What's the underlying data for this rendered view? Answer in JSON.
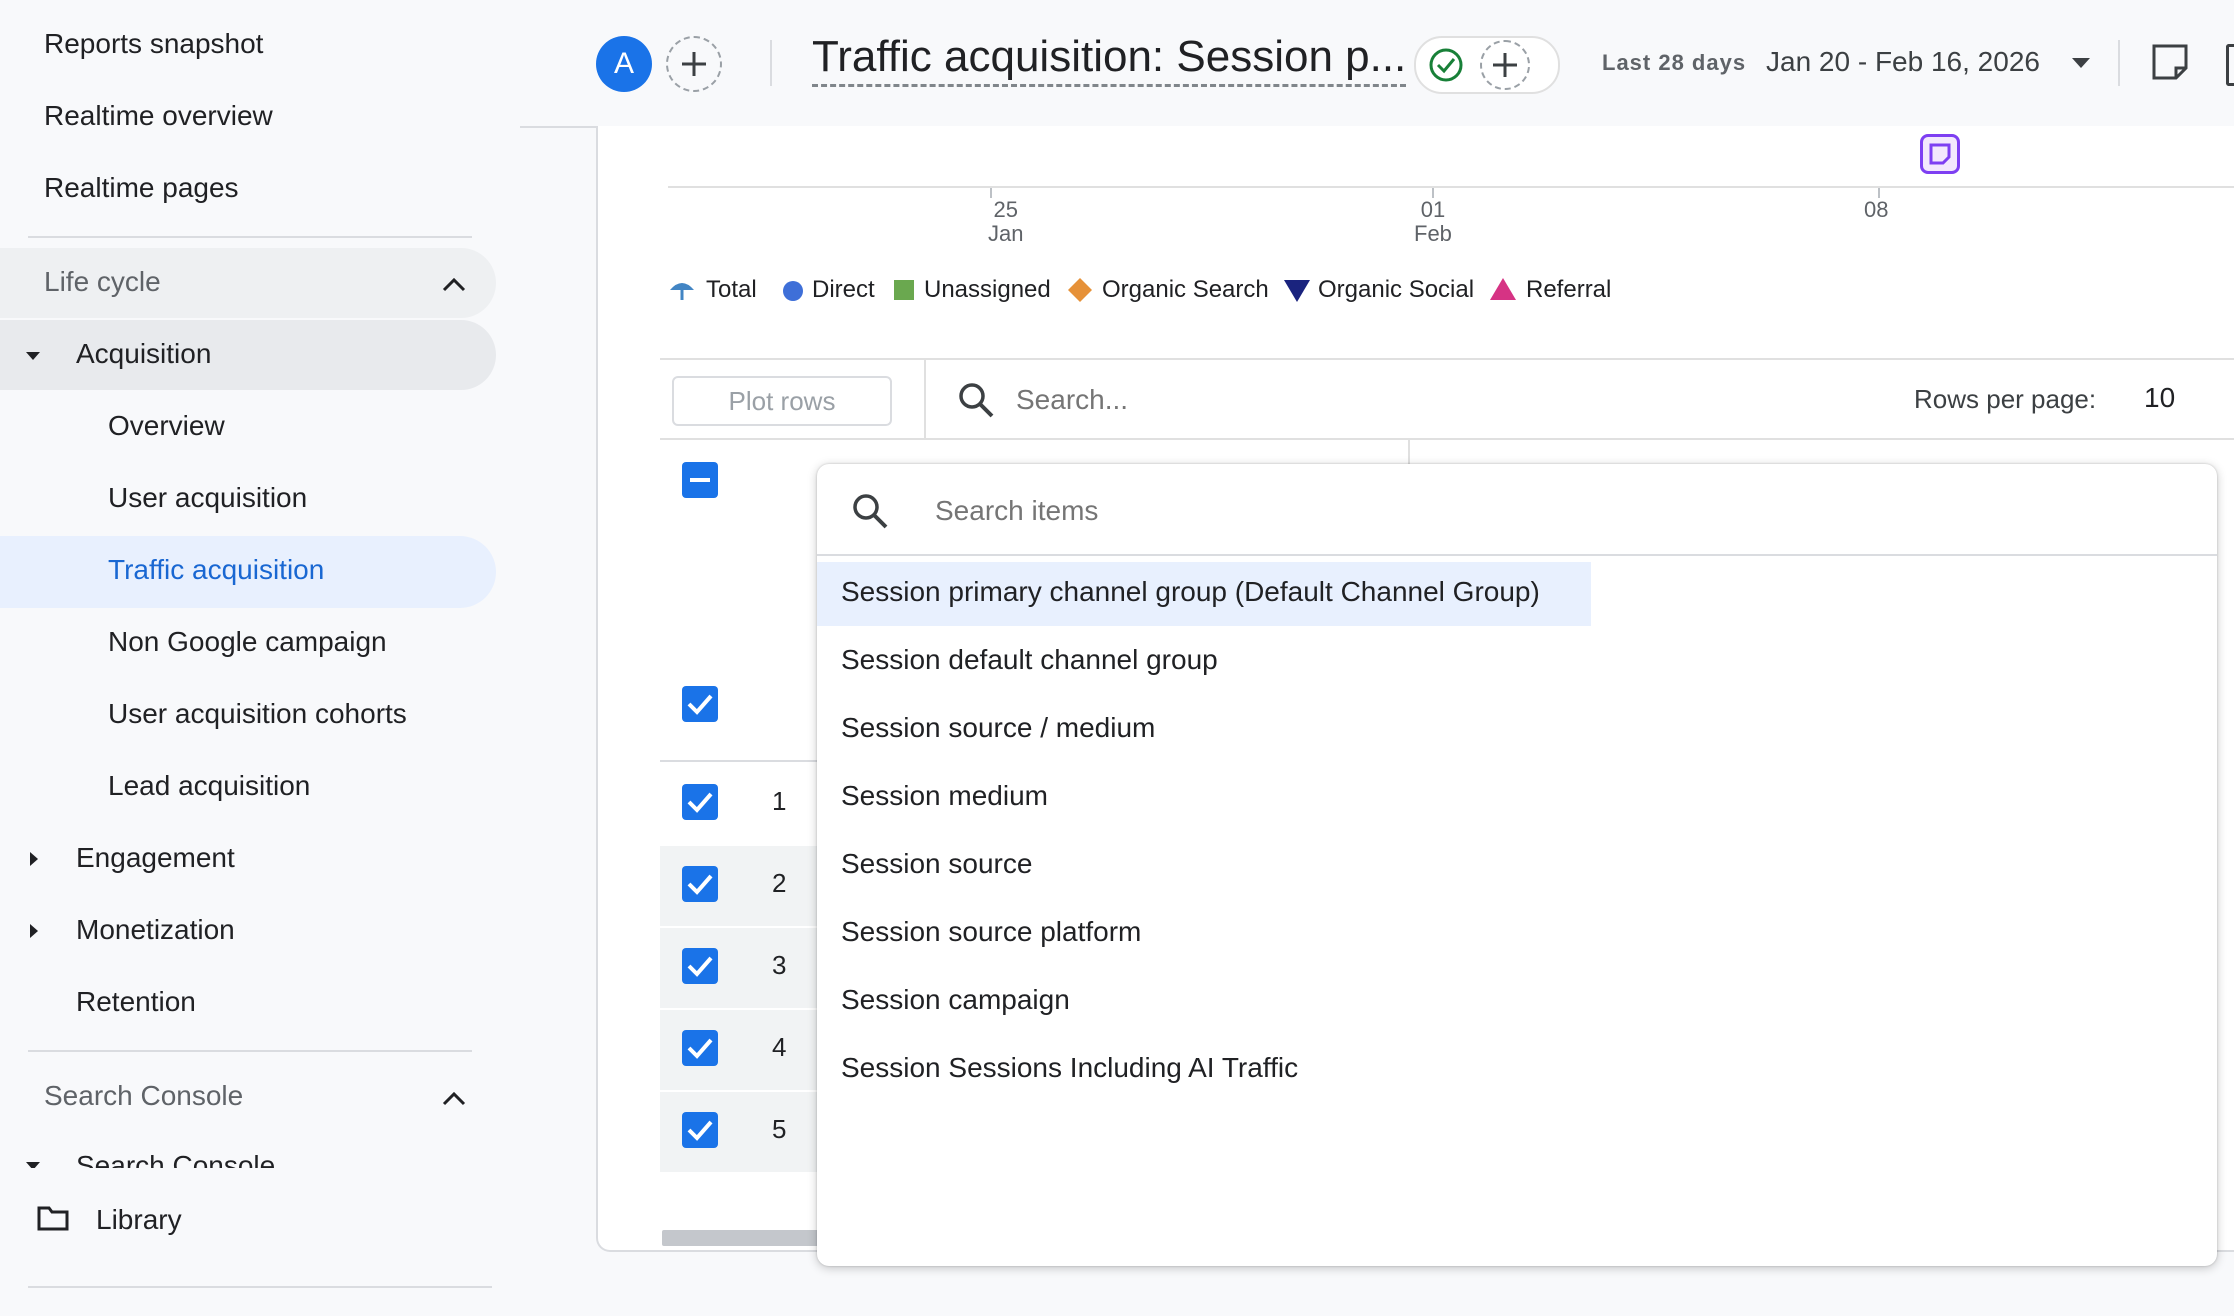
{
  "sidebar": {
    "top_items": [
      "Reports snapshot",
      "Realtime overview",
      "Realtime pages"
    ],
    "lifecycle": {
      "label": "Life cycle",
      "acquisition": {
        "label": "Acquisition",
        "children": [
          "Overview",
          "User acquisition",
          "Traffic acquisition",
          "Non Google campaign",
          "User acquisition cohorts",
          "Lead acquisition"
        ],
        "active": "Traffic acquisition"
      },
      "engagement": "Engagement",
      "monetization": "Monetization",
      "retention": "Retention"
    },
    "search_console": {
      "label": "Search Console",
      "child_partial": "Search Console"
    },
    "library": "Library"
  },
  "header": {
    "avatar_letter": "A",
    "title": "Traffic acquisition: Session p...",
    "date_label": "Last 28 days",
    "date_range": "Jan 20 - Feb 16, 2026"
  },
  "chart": {
    "x_ticks": [
      {
        "day": "25",
        "month": "Jan"
      },
      {
        "day": "01",
        "month": "Feb"
      },
      {
        "day": "08",
        "month": ""
      }
    ],
    "legend": [
      {
        "name": "Total",
        "color": "#4285c4",
        "shape": "umbrella"
      },
      {
        "name": "Direct",
        "color": "#3e6fd8",
        "shape": "circle"
      },
      {
        "name": "Unassigned",
        "color": "#6aa84f",
        "shape": "square"
      },
      {
        "name": "Organic Search",
        "color": "#e69138",
        "shape": "diamond"
      },
      {
        "name": "Organic Social",
        "color": "#1a237e",
        "shape": "triangle-down"
      },
      {
        "name": "Referral",
        "color": "#d63384",
        "shape": "triangle-up"
      }
    ]
  },
  "table": {
    "plot_rows_label": "Plot rows",
    "search_placeholder": "Search...",
    "rows_per_page_label": "Rows per page:",
    "rows_per_page_value": "10",
    "row_numbers": [
      "1",
      "2",
      "3",
      "4",
      "5"
    ]
  },
  "dropdown": {
    "search_placeholder": "Search items",
    "items": [
      "Session primary channel group (Default Channel Group)",
      "Session default channel group",
      "Session source / medium",
      "Session medium",
      "Session source",
      "Session source platform",
      "Session campaign",
      "Session Sessions Including AI Traffic"
    ],
    "selected": "Session primary channel group (Default Channel Group)"
  }
}
